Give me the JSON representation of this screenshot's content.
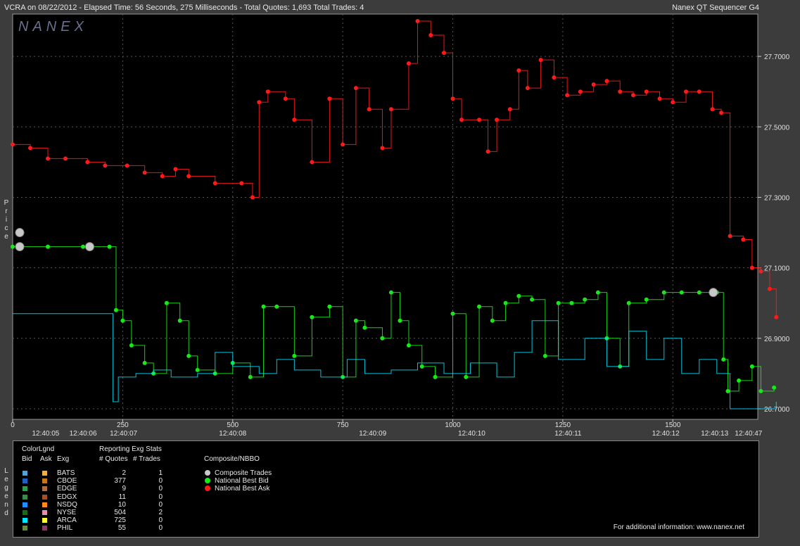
{
  "header": {
    "left": "VCRA on 08/22/2012  -  Elapsed Time: 56 Seconds, 275 Milliseconds  -  Total Quotes: 1,693  Total Trades: 4",
    "right": "Nanex QT Sequencer G4"
  },
  "watermark": "NANEX",
  "side_labels": {
    "price": [
      "P",
      "r",
      "i",
      "c",
      "e"
    ],
    "legend": [
      "L",
      "e",
      "g",
      "e",
      "n",
      "d"
    ]
  },
  "chart_data": {
    "type": "line",
    "ylabel": "Price",
    "yticks": [
      26.7,
      26.9,
      27.1,
      27.3,
      27.5,
      27.7
    ],
    "ytick_labels": [
      "26.7000",
      "26.9000",
      "27.1000",
      "27.3000",
      "27.5000",
      "27.7000"
    ],
    "ylim": [
      26.67,
      27.82
    ],
    "xlim": [
      0,
      1693
    ],
    "xticks_numeric": [
      0,
      250,
      500,
      750,
      1000,
      1250,
      1500
    ],
    "xtick_labels_numeric": [
      "0",
      "250",
      "500",
      "750",
      "1000",
      "1250",
      "1500"
    ],
    "time_labels": [
      {
        "x": 75,
        "label": "12:40:05"
      },
      {
        "x": 160,
        "label": "12:40:06"
      },
      {
        "x": 252,
        "label": "12:40:07"
      },
      {
        "x": 500,
        "label": "12:40:08"
      },
      {
        "x": 818,
        "label": "12:40:09"
      },
      {
        "x": 1043,
        "label": "12:40:10"
      },
      {
        "x": 1262,
        "label": "12:40:11"
      },
      {
        "x": 1484,
        "label": "12:40:12"
      },
      {
        "x": 1595,
        "label": "12:40:13"
      },
      {
        "x": 1672,
        "label": "12:40:47"
      }
    ],
    "grid": true,
    "series": [
      {
        "name": "National Best Ask",
        "color": "#ff1a1a",
        "points": [
          [
            0,
            27.45
          ],
          [
            40,
            27.44
          ],
          [
            80,
            27.41
          ],
          [
            120,
            27.41
          ],
          [
            170,
            27.4
          ],
          [
            210,
            27.39
          ],
          [
            260,
            27.39
          ],
          [
            300,
            27.37
          ],
          [
            340,
            27.36
          ],
          [
            370,
            27.38
          ],
          [
            400,
            27.36
          ],
          [
            460,
            27.34
          ],
          [
            520,
            27.34
          ],
          [
            545,
            27.3
          ],
          [
            560,
            27.57
          ],
          [
            580,
            27.6
          ],
          [
            620,
            27.58
          ],
          [
            640,
            27.52
          ],
          [
            680,
            27.4
          ],
          [
            720,
            27.58
          ],
          [
            750,
            27.45
          ],
          [
            780,
            27.61
          ],
          [
            810,
            27.55
          ],
          [
            840,
            27.44
          ],
          [
            860,
            27.55
          ],
          [
            900,
            27.68
          ],
          [
            920,
            27.8
          ],
          [
            950,
            27.76
          ],
          [
            980,
            27.71
          ],
          [
            1000,
            27.58
          ],
          [
            1020,
            27.52
          ],
          [
            1060,
            27.52
          ],
          [
            1080,
            27.43
          ],
          [
            1100,
            27.52
          ],
          [
            1130,
            27.55
          ],
          [
            1150,
            27.66
          ],
          [
            1170,
            27.61
          ],
          [
            1200,
            27.69
          ],
          [
            1230,
            27.64
          ],
          [
            1260,
            27.59
          ],
          [
            1290,
            27.6
          ],
          [
            1320,
            27.62
          ],
          [
            1350,
            27.63
          ],
          [
            1380,
            27.6
          ],
          [
            1410,
            27.59
          ],
          [
            1440,
            27.6
          ],
          [
            1470,
            27.58
          ],
          [
            1500,
            27.57
          ],
          [
            1530,
            27.6
          ],
          [
            1560,
            27.6
          ],
          [
            1590,
            27.55
          ],
          [
            1610,
            27.54
          ],
          [
            1630,
            27.19
          ],
          [
            1660,
            27.18
          ],
          [
            1680,
            27.1
          ],
          [
            1700,
            27.09
          ],
          [
            1720,
            27.04
          ],
          [
            1735,
            26.96
          ]
        ]
      },
      {
        "name": "National Best Bid",
        "color": "#18e818",
        "points": [
          [
            0,
            27.16
          ],
          [
            80,
            27.16
          ],
          [
            160,
            27.16
          ],
          [
            220,
            27.16
          ],
          [
            235,
            26.98
          ],
          [
            250,
            26.95
          ],
          [
            270,
            26.88
          ],
          [
            300,
            26.83
          ],
          [
            320,
            26.8
          ],
          [
            350,
            27.0
          ],
          [
            380,
            26.95
          ],
          [
            400,
            26.85
          ],
          [
            420,
            26.81
          ],
          [
            460,
            26.8
          ],
          [
            500,
            26.83
          ],
          [
            540,
            26.79
          ],
          [
            570,
            26.99
          ],
          [
            600,
            26.99
          ],
          [
            640,
            26.85
          ],
          [
            680,
            26.96
          ],
          [
            720,
            26.99
          ],
          [
            750,
            26.79
          ],
          [
            780,
            26.95
          ],
          [
            800,
            26.93
          ],
          [
            840,
            26.9
          ],
          [
            860,
            27.03
          ],
          [
            880,
            26.95
          ],
          [
            900,
            26.88
          ],
          [
            930,
            26.82
          ],
          [
            960,
            26.79
          ],
          [
            1000,
            26.97
          ],
          [
            1030,
            26.79
          ],
          [
            1060,
            26.99
          ],
          [
            1090,
            26.95
          ],
          [
            1120,
            27.0
          ],
          [
            1150,
            27.02
          ],
          [
            1180,
            27.01
          ],
          [
            1210,
            26.85
          ],
          [
            1240,
            27.0
          ],
          [
            1270,
            27.0
          ],
          [
            1300,
            27.01
          ],
          [
            1330,
            27.03
          ],
          [
            1350,
            26.9
          ],
          [
            1380,
            26.82
          ],
          [
            1400,
            27.0
          ],
          [
            1440,
            27.01
          ],
          [
            1480,
            27.03
          ],
          [
            1520,
            27.03
          ],
          [
            1560,
            27.03
          ],
          [
            1600,
            27.03
          ],
          [
            1615,
            26.84
          ],
          [
            1625,
            26.75
          ],
          [
            1650,
            26.78
          ],
          [
            1680,
            26.82
          ],
          [
            1700,
            26.75
          ],
          [
            1730,
            26.76
          ]
        ]
      },
      {
        "name": "ARCA",
        "color": "#00e5ff",
        "points": [
          [
            0,
            26.97
          ],
          [
            220,
            26.97
          ],
          [
            228,
            26.72
          ],
          [
            240,
            26.79
          ],
          [
            280,
            26.8
          ],
          [
            320,
            26.81
          ],
          [
            360,
            26.79
          ],
          [
            420,
            26.8
          ],
          [
            460,
            26.86
          ],
          [
            500,
            26.82
          ],
          [
            560,
            26.8
          ],
          [
            600,
            26.84
          ],
          [
            640,
            26.81
          ],
          [
            700,
            26.79
          ],
          [
            760,
            26.84
          ],
          [
            800,
            26.8
          ],
          [
            860,
            26.81
          ],
          [
            920,
            26.83
          ],
          [
            980,
            26.8
          ],
          [
            1040,
            26.83
          ],
          [
            1100,
            26.79
          ],
          [
            1140,
            26.86
          ],
          [
            1180,
            26.95
          ],
          [
            1240,
            26.84
          ],
          [
            1300,
            26.9
          ],
          [
            1350,
            26.82
          ],
          [
            1400,
            26.92
          ],
          [
            1440,
            26.84
          ],
          [
            1480,
            26.9
          ],
          [
            1520,
            26.8
          ],
          [
            1560,
            26.84
          ],
          [
            1600,
            26.8
          ],
          [
            1630,
            26.7
          ],
          [
            1700,
            26.7
          ],
          [
            1735,
            26.72
          ]
        ]
      }
    ],
    "composite_trades": [
      [
        0,
        27.2
      ],
      [
        0,
        27.16
      ],
      [
        175,
        27.16
      ],
      [
        1592,
        27.03
      ]
    ]
  },
  "legend": {
    "title": "ColorLgnd",
    "col_bid": "Bid",
    "col_ask": "Ask",
    "col_exg": "Exg",
    "stats_title": "Reporting Exg Stats",
    "col_quotes": "# Quotes",
    "col_trades": "# Trades",
    "nbbo_title": "Composite/NBBO",
    "exchanges": [
      {
        "name": "BATS",
        "quotes": "2",
        "trades": "1",
        "bid_color": "#4fa3e0",
        "ask_color": "#f0b040"
      },
      {
        "name": "CBOE",
        "quotes": "377",
        "trades": "0",
        "bid_color": "#1f5fbf",
        "ask_color": "#c8761e"
      },
      {
        "name": "EDGE",
        "quotes": "9",
        "trades": "0",
        "bid_color": "#2e9e4e",
        "ask_color": "#b56a3a"
      },
      {
        "name": "EDGX",
        "quotes": "11",
        "trades": "0",
        "bid_color": "#3a8a4a",
        "ask_color": "#a0502a"
      },
      {
        "name": "NSDQ",
        "quotes": "10",
        "trades": "0",
        "bid_color": "#1e90ff",
        "ask_color": "#ff8c1a"
      },
      {
        "name": "NYSE",
        "quotes": "504",
        "trades": "2",
        "bid_color": "#1a6a1a",
        "ask_color": "#e090b0"
      },
      {
        "name": "ARCA",
        "quotes": "725",
        "trades": "0",
        "bid_color": "#00e5ff",
        "ask_color": "#ffff33"
      },
      {
        "name": "PHIL",
        "quotes": "55",
        "trades": "0",
        "bid_color": "#6a8a3a",
        "ask_color": "#8a3a6a"
      }
    ],
    "nbbo": [
      {
        "label": "Composite Trades",
        "color": "#c8c8c8"
      },
      {
        "label": "National Best Bid",
        "color": "#18e818"
      },
      {
        "label": "National Best Ask",
        "color": "#ff1a1a"
      }
    ],
    "footer": "For additional information: www.nanex.net"
  }
}
